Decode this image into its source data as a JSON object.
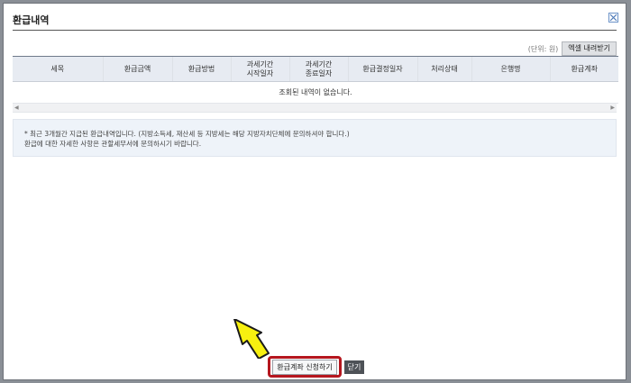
{
  "dialog": {
    "title": "환급내역",
    "unit_label": "(단위: 원)",
    "excel_button": "엑셀 내려받기"
  },
  "table": {
    "columns": [
      "세목",
      "환급금액",
      "환급방법",
      "과세기간\n시작일자",
      "과세기간\n종료일자",
      "환급결정일자",
      "처리상태",
      "은행명",
      "환급계좌"
    ],
    "empty_message": "조회된 내역이 없습니다."
  },
  "notice": {
    "line1": "* 최근 3개월간 지급된 환급내역입니다. (지방소득세, 재산세 등 지방세는 해당 지방자치단체에 문의하셔야 합니다.)",
    "line2": "환급에 대한 자세한 사항은 관할세무서에 문의하시기 바랍니다."
  },
  "buttons": {
    "apply": "환급계좌 신청하기",
    "close": "닫기"
  },
  "colors": {
    "highlight_border": "#b5161e",
    "pointer_fill": "#f7f010",
    "header_bg": "#e7ebf2",
    "notice_bg": "#eef3f9"
  },
  "icons": {
    "close": "close-icon",
    "pointer": "arrow-pointer-icon",
    "scroll_left": "scroll-left-icon",
    "scroll_right": "scroll-right-icon"
  }
}
